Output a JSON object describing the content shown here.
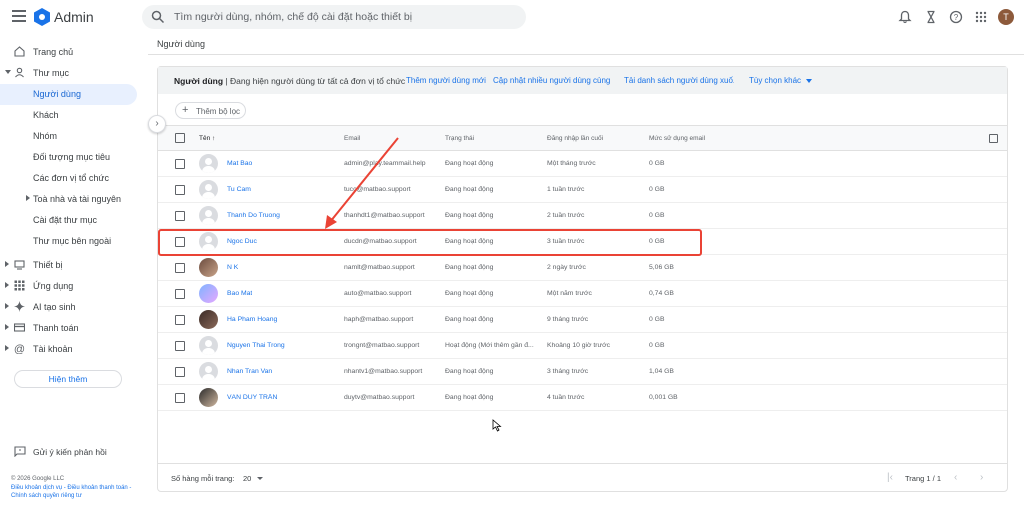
{
  "header": {
    "app_title": "Admin",
    "search_placeholder": "Tìm người dùng, nhóm, chế độ cài đặt hoặc thiết bị",
    "avatar_letter": "T"
  },
  "sidebar": {
    "items": [
      {
        "label": "Trang chủ",
        "icon": "home-icon"
      },
      {
        "label": "Thư mục",
        "icon": "person-icon"
      },
      {
        "label": "Người dùng"
      },
      {
        "label": "Khách"
      },
      {
        "label": "Nhóm"
      },
      {
        "label": "Đối tượng mục tiêu"
      },
      {
        "label": "Các đơn vị tổ chức"
      },
      {
        "label": "Toà nhà và tài nguyên"
      },
      {
        "label": "Cài đặt thư mục"
      },
      {
        "label": "Thư mục bên ngoài"
      },
      {
        "label": "Thiết bị",
        "icon": "devices-icon"
      },
      {
        "label": "Ứng dụng",
        "icon": "apps-grid-icon"
      },
      {
        "label": "AI tạo sinh",
        "icon": "sparkle-icon"
      },
      {
        "label": "Thanh toán",
        "icon": "credit-card-icon"
      },
      {
        "label": "Tài khoản",
        "icon": "at-sign-icon"
      }
    ],
    "show_more": "Hiện thêm",
    "feedback": "Gửi ý kiến phản hồi",
    "footer": {
      "copyright": "© 2026 Google LLC",
      "links": "Điều khoản dịch vụ - Điều khoản thanh toán - Chính sách quyền riêng tư"
    }
  },
  "breadcrumb": "Người dùng",
  "card": {
    "title_bold": "Người dùng",
    "title_rest": " | Đang hiện người dùng từ tất cả đơn vị tổ chức",
    "links": [
      "Thêm người dùng mới",
      "Cập nhật nhiều người dùng cùng l...",
      "Tải danh sách người dùng xuố...",
      "Tùy chọn khác"
    ],
    "add_filter": "Thêm bộ lọc"
  },
  "table": {
    "columns": [
      "Tên",
      "Email",
      "Trạng thái",
      "Đăng nhập lần cuối",
      "Mức sử dụng email"
    ],
    "rows": [
      {
        "name": "Mat Bao",
        "email": "admin@play.teammail.help",
        "status": "Đang hoạt động",
        "login": "Một tháng trước",
        "usage": "0 GB"
      },
      {
        "name": "Tu Cam",
        "email": "tucc@matbao.support",
        "status": "Đang hoạt động",
        "login": "1 tuần trước",
        "usage": "0 GB"
      },
      {
        "name": "Thanh Do Truong",
        "email": "thanhdt1@matbao.support",
        "status": "Đang hoạt động",
        "login": "2 tuần trước",
        "usage": "0 GB"
      },
      {
        "name": "Ngoc Duc",
        "email": "ducdn@matbao.support",
        "status": "Đang hoạt động",
        "login": "3 tuần trước",
        "usage": "0 GB"
      },
      {
        "name": "N K",
        "email": "namlt@matbao.support",
        "status": "Đang hoạt động",
        "login": "2 ngày trước",
        "usage": "5,06 GB"
      },
      {
        "name": "Bao Mat",
        "email": "auto@matbao.support",
        "status": "Đang hoạt động",
        "login": "Một năm trước",
        "usage": "0,74 GB"
      },
      {
        "name": "Ha Pham Hoang",
        "email": "haph@matbao.support",
        "status": "Đang hoạt động",
        "login": "9 tháng trước",
        "usage": "0 GB"
      },
      {
        "name": "Nguyen Thai Trong",
        "email": "trongnt@matbao.support",
        "status": "Hoạt động (Mới thêm gần đ...",
        "login": "Khoảng 10 giờ trước",
        "usage": "0 GB"
      },
      {
        "name": "Nhan Tran Van",
        "email": "nhantv1@matbao.support",
        "status": "Đang hoạt động",
        "login": "3 tháng trước",
        "usage": "1,04 GB"
      },
      {
        "name": "VĂN DUY TRẦN",
        "email": "duytv@matbao.support",
        "status": "Đang hoạt động",
        "login": "4 tuần trước",
        "usage": "0,001 GB"
      }
    ]
  },
  "pager": {
    "rows_per_page_label": "Số hàng mỗi trang:",
    "rows_per_page": "20",
    "page_label": "Trang 1 / 1"
  },
  "colors": {
    "accent": "#1a73e8",
    "highlight": "#ea4335",
    "active_bg": "#e8f0fe"
  }
}
